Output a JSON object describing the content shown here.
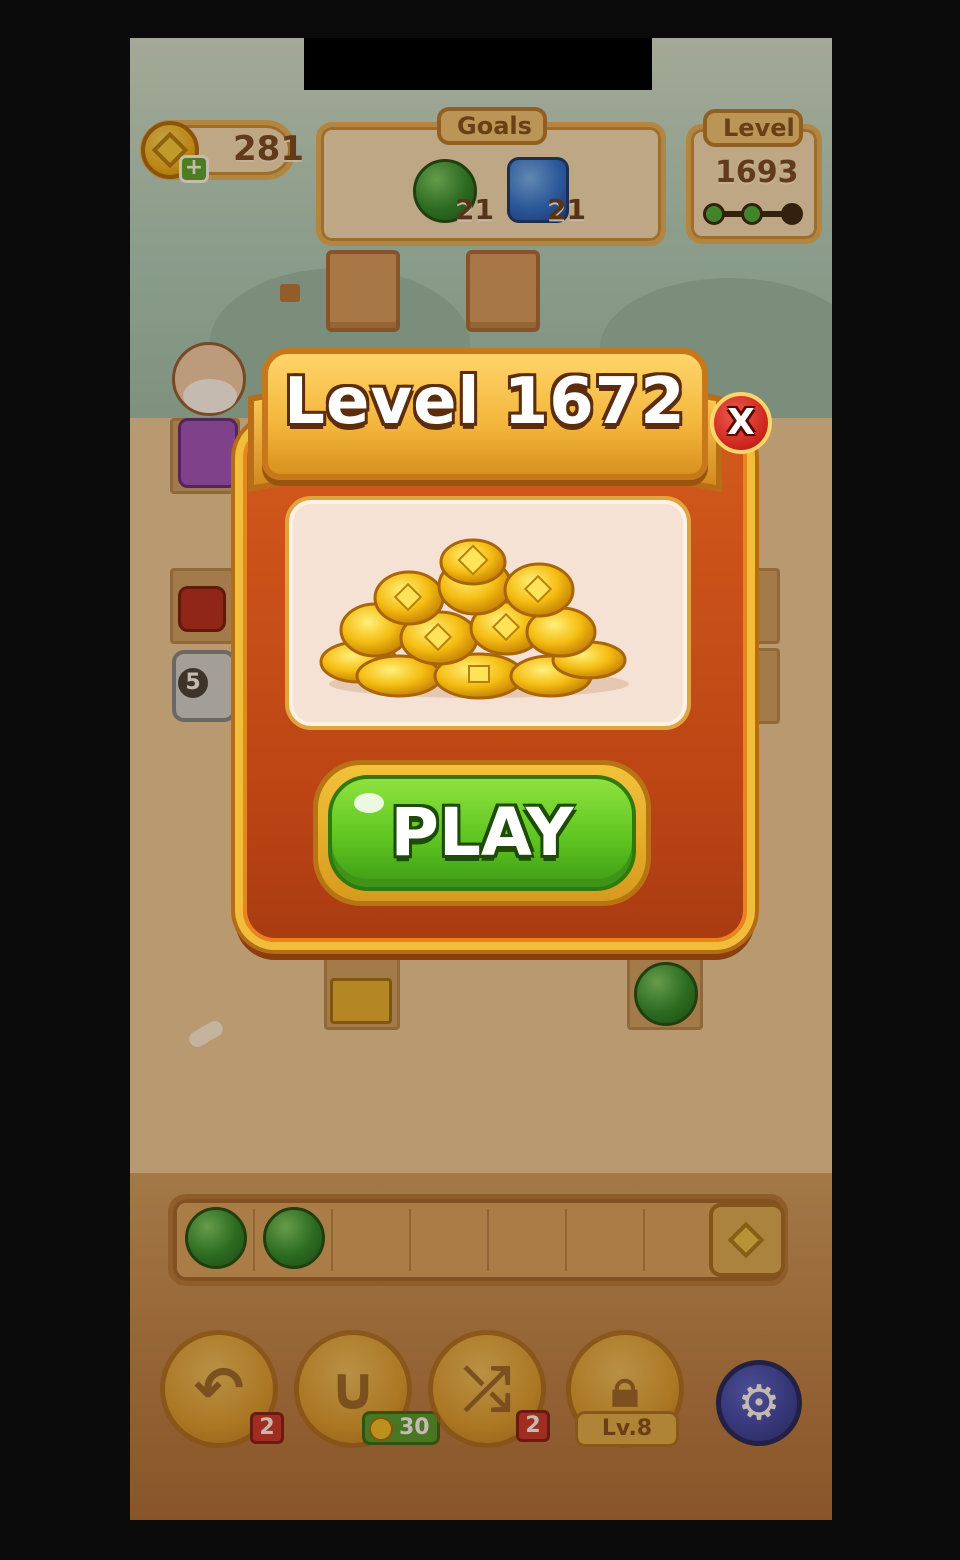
{
  "hud": {
    "coins": "281",
    "coins_plus": "+",
    "goals_title": "Goals",
    "goals": [
      {
        "gem": "green-gem-icon",
        "count": "21"
      },
      {
        "gem": "blue-gem-icon",
        "count": "21"
      }
    ],
    "level_title": "Level",
    "level_number": "1693",
    "level_progress": [
      1,
      1,
      0
    ]
  },
  "board": {
    "block_counter": "5"
  },
  "modal": {
    "title": "Level 1672",
    "close_label": "X",
    "reward_image": "gold-coins-pile-icon",
    "play_label": "PLAY"
  },
  "tray": {
    "slots_total": 7,
    "filled": [
      "green-gem-icon",
      "green-gem-icon"
    ],
    "end_icon": "diamond-icon"
  },
  "boosters": [
    {
      "name": "undo",
      "icon": "undo-icon",
      "badge": "2"
    },
    {
      "name": "magnet",
      "icon": "magnet-icon",
      "badge": "30"
    },
    {
      "name": "shuffle",
      "icon": "shuffle-icon",
      "badge": "2"
    },
    {
      "name": "locked",
      "icon": "lock-icon",
      "badge": "Lv.8"
    }
  ],
  "settings": {
    "icon": "gear-icon"
  },
  "colors": {
    "modal_border": "#f2bd3a",
    "modal_body": "#c24b17",
    "play_green": "#5fc521",
    "close_red": "#c9241c",
    "settings_blue": "#2a39a6"
  }
}
